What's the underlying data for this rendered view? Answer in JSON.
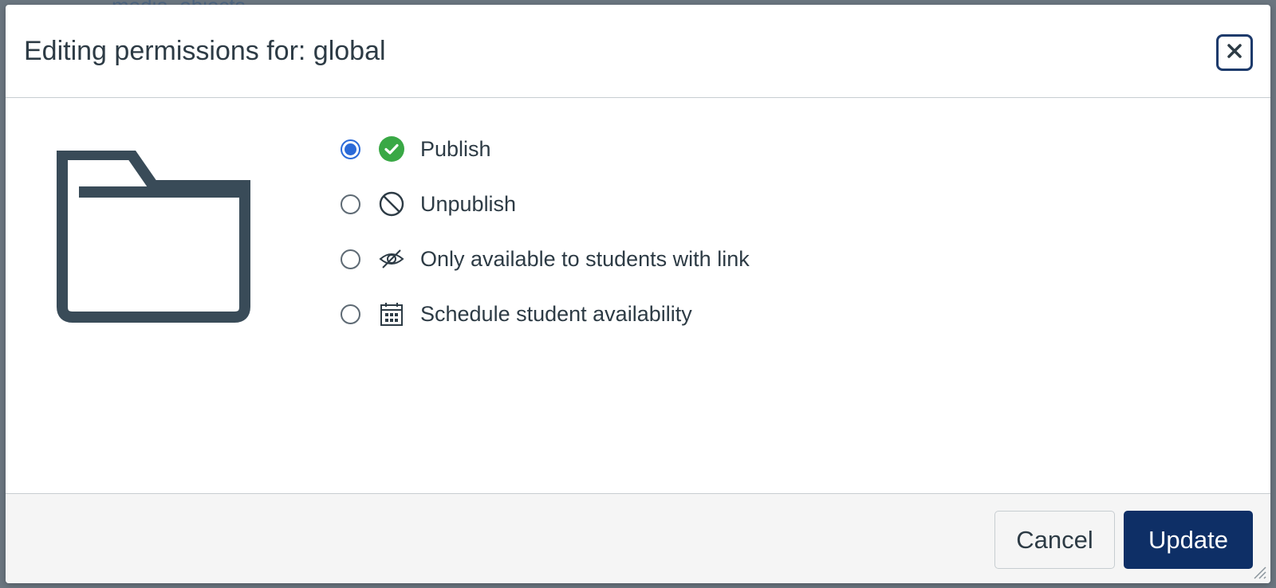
{
  "background": {
    "peek_text": "media_objects"
  },
  "dialog": {
    "title": "Editing permissions for: global",
    "close_icon": "close-icon",
    "options": [
      {
        "label": "Publish",
        "icon": "published-check-icon",
        "checked": true
      },
      {
        "label": "Unpublish",
        "icon": "unpublish-icon",
        "checked": false
      },
      {
        "label": "Only available to students with link",
        "icon": "eye-off-icon",
        "checked": false
      },
      {
        "label": "Schedule student availability",
        "icon": "calendar-icon",
        "checked": false
      }
    ],
    "buttons": {
      "cancel": "Cancel",
      "update": "Update"
    }
  },
  "colors": {
    "accent": "#2b6ad8",
    "primary_button": "#0e2f66",
    "publish_green": "#39a845",
    "text": "#2d3b45",
    "folder": "#394b58"
  }
}
